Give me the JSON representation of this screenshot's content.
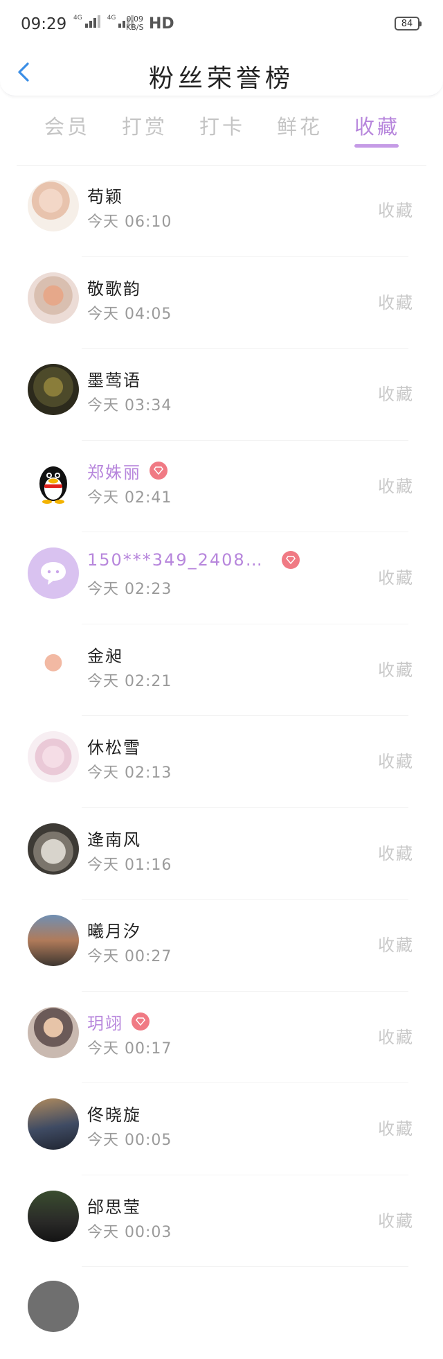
{
  "status_bar": {
    "time": "09:29",
    "net_tag_1": "4G",
    "net_tag_2": "4G",
    "speed_value": "0.09",
    "speed_unit": "KB/S",
    "hd": "HD",
    "battery": "84"
  },
  "header": {
    "title": "粉丝荣誉榜",
    "back_icon": "chevron-left-icon"
  },
  "tabs": [
    {
      "label": "会员",
      "active": false
    },
    {
      "label": "打赏",
      "active": false
    },
    {
      "label": "打卡",
      "active": false
    },
    {
      "label": "鲜花",
      "active": false
    },
    {
      "label": "收藏",
      "active": true
    }
  ],
  "colors": {
    "accent": "#b786dc",
    "back_arrow": "#3a8ee6",
    "vip_badge": "#f07a84",
    "muted_text": "#c9c9c9"
  },
  "list": [
    {
      "name": "苟颖",
      "time": "今天 06:10",
      "action": "收藏",
      "vip": false
    },
    {
      "name": "敬歌韵",
      "time": "今天 04:05",
      "action": "收藏",
      "vip": false
    },
    {
      "name": "墨莺语",
      "time": "今天 03:34",
      "action": "收藏",
      "vip": false
    },
    {
      "name": "郑姝丽",
      "time": "今天 02:41",
      "action": "收藏",
      "vip": true
    },
    {
      "name": "150***349_2408…",
      "time": "今天 02:23",
      "action": "收藏",
      "vip": true
    },
    {
      "name": "金昶",
      "time": "今天 02:21",
      "action": "收藏",
      "vip": false
    },
    {
      "name": "休松雪",
      "time": "今天 02:13",
      "action": "收藏",
      "vip": false
    },
    {
      "name": "逄南风",
      "time": "今天 01:16",
      "action": "收藏",
      "vip": false
    },
    {
      "name": "曦月汐",
      "time": "今天 00:27",
      "action": "收藏",
      "vip": false
    },
    {
      "name": "玥翊",
      "time": "今天 00:17",
      "action": "收藏",
      "vip": true
    },
    {
      "name": "佟晓旋",
      "time": "今天 00:05",
      "action": "收藏",
      "vip": false
    },
    {
      "name": "邰思莹",
      "time": "今天 00:03",
      "action": "收藏",
      "vip": false
    }
  ]
}
